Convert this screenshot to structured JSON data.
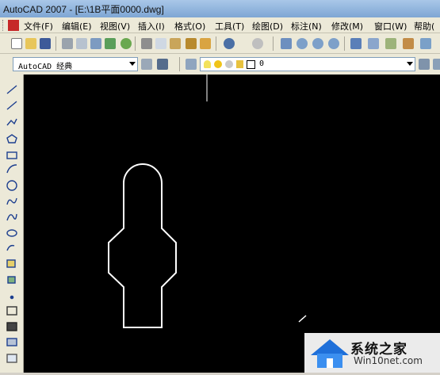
{
  "window": {
    "title": "AutoCAD 2007 - [E:\\1B平面0000.dwg]"
  },
  "menu": {
    "items": [
      {
        "label": "文件(F)"
      },
      {
        "label": "编辑(E)"
      },
      {
        "label": "视图(V)"
      },
      {
        "label": "插入(I)"
      },
      {
        "label": "格式(O)"
      },
      {
        "label": "工具(T)"
      },
      {
        "label": "绘图(D)"
      },
      {
        "label": "标注(N)"
      },
      {
        "label": "修改(M)"
      },
      {
        "label": "窗口(W)"
      },
      {
        "label": "帮助("
      }
    ]
  },
  "toolbar2": {
    "workspace_value": "AutoCAD 经典",
    "layer_value": "0"
  },
  "watermark": {
    "line1": "系统之家",
    "line2": "Win10net.com"
  },
  "colors": {
    "canvas": "#000000",
    "drawing": "#ffffff",
    "chrome": "#ece9d8",
    "titlebar": "#7ea6d4"
  }
}
